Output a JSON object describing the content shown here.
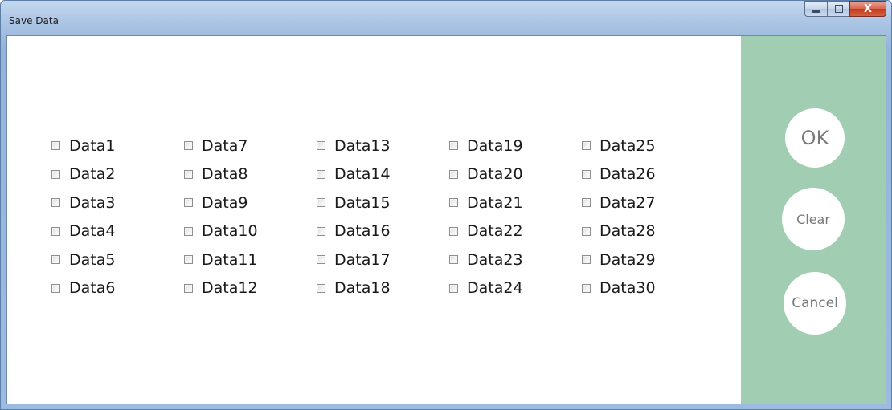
{
  "window": {
    "title": "Save Data",
    "controls": {
      "minimize_icon": "minimize-icon",
      "maximize_icon": "maximize-icon",
      "close_glyph": "X"
    }
  },
  "checkboxes": {
    "columns": [
      [
        "Data1",
        "Data2",
        "Data3",
        "Data4",
        "Data5",
        "Data6"
      ],
      [
        "Data7",
        "Data8",
        "Data9",
        "Data10",
        "Data11",
        "Data12"
      ],
      [
        "Data13",
        "Data14",
        "Data15",
        "Data16",
        "Data17",
        "Data18"
      ],
      [
        "Data19",
        "Data20",
        "Data21",
        "Data22",
        "Data23",
        "Data24"
      ],
      [
        "Data25",
        "Data26",
        "Data27",
        "Data28",
        "Data29",
        "Data30"
      ]
    ],
    "checked": false
  },
  "actions": {
    "ok_label": "OK",
    "clear_label": "Clear",
    "cancel_label": "Cancel"
  },
  "colors": {
    "action_panel": "#a1cdb2",
    "button_fill": "#ffffff",
    "button_text": "#7a7a7a"
  }
}
